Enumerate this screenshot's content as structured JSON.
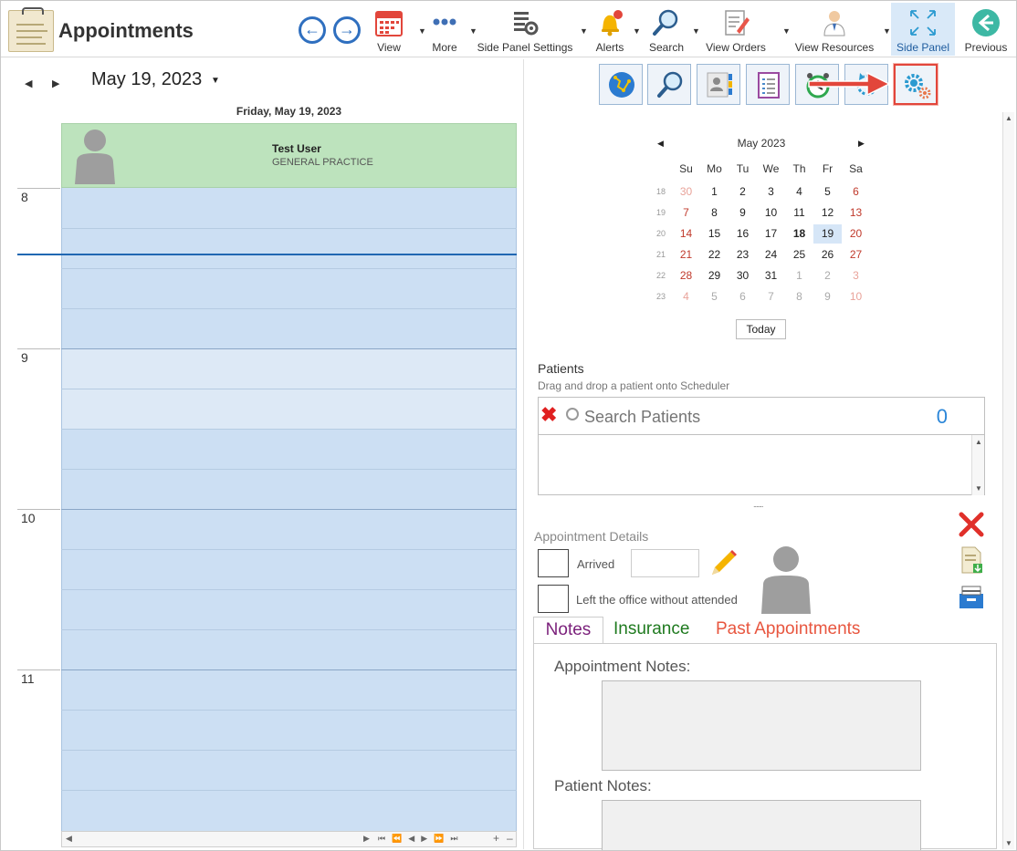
{
  "app": {
    "title": "Appointments"
  },
  "toolbar": {
    "view_label": "View",
    "more_label": "More",
    "side_panel_settings_label": "Side Panel Settings",
    "alerts_label": "Alerts",
    "search_label": "Search",
    "view_orders_label": "View Orders",
    "view_resources_label": "View Resources",
    "side_panel_label": "Side Panel",
    "previous_label": "Previous"
  },
  "scheduler": {
    "month_year": "May 19, 2023",
    "day_header": "Friday, May 19, 2023",
    "resource_name": "Test User",
    "resource_dept": "GENERAL PRACTICE",
    "hours": [
      "8",
      "9",
      "10",
      "11"
    ]
  },
  "mini_calendar": {
    "title": "May 2023",
    "weekdays": [
      "Su",
      "Mo",
      "Tu",
      "We",
      "Th",
      "Fr",
      "Sa"
    ],
    "weeks": [
      {
        "num": "18",
        "days": [
          "30",
          "1",
          "2",
          "3",
          "4",
          "5",
          "6"
        ]
      },
      {
        "num": "19",
        "days": [
          "7",
          "8",
          "9",
          "10",
          "11",
          "12",
          "13"
        ]
      },
      {
        "num": "20",
        "days": [
          "14",
          "15",
          "16",
          "17",
          "18",
          "19",
          "20"
        ]
      },
      {
        "num": "21",
        "days": [
          "21",
          "22",
          "23",
          "24",
          "25",
          "26",
          "27"
        ]
      },
      {
        "num": "22",
        "days": [
          "28",
          "29",
          "30",
          "31",
          "1",
          "2",
          "3"
        ]
      },
      {
        "num": "23",
        "days": [
          "4",
          "5",
          "6",
          "7",
          "8",
          "9",
          "10"
        ]
      }
    ],
    "today_label": "Today",
    "weekend_color": "#c0392b",
    "selected_bg": "#d6e6f7"
  },
  "patients": {
    "title": "Patients",
    "subtitle": "Drag and drop a patient onto Scheduler",
    "search_placeholder": "Search Patients",
    "count": "0"
  },
  "appointment_details": {
    "title": "Appointment Details",
    "arrived_label": "Arrived",
    "left_label": "Left the office without attended"
  },
  "tabs": {
    "notes": "Notes",
    "insurance": "Insurance",
    "past": "Past Appointments"
  },
  "notes_panel": {
    "appointment_notes_label": "Appointment Notes:",
    "patient_notes_label": "Patient Notes:"
  },
  "colors": {
    "accent": "#2f6fbf",
    "schedule_bg": "#ccdff3",
    "resource_bg": "#bde3bd",
    "highlight": "#e2463b"
  }
}
